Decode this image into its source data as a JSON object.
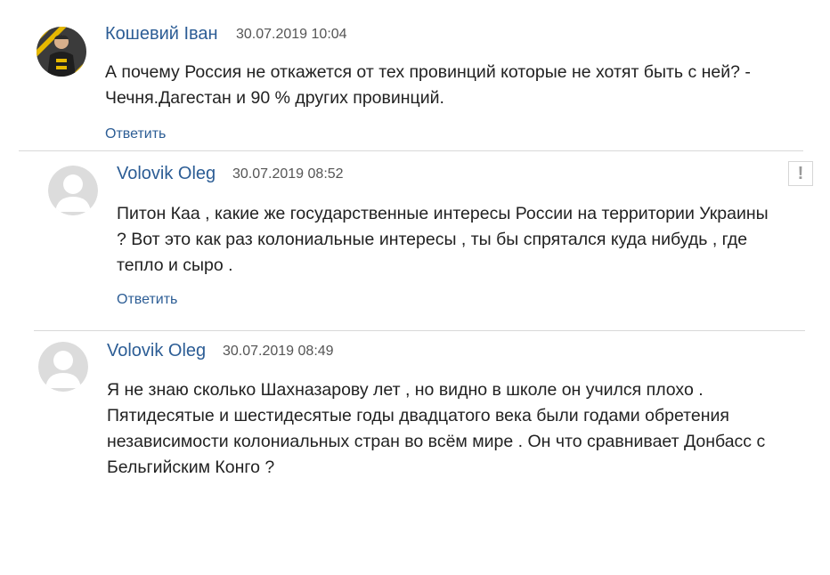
{
  "comments": [
    {
      "author": "Кошевий Іван",
      "date": "30.07.2019 10:04",
      "text": "А почему Россия не откажется от тех провинций которые не хотят быть с ней? - Чечня.Дагестан и 90 % других провинций.",
      "reply_label": "Ответить",
      "avatar_icon": "user-photo-avatar"
    },
    {
      "author": "Volovik Oleg",
      "date": "30.07.2019 08:52",
      "text": "Питон Каа , какие же государственные интересы России на территории Украины ? Вот это как раз колониальные интересы , ты бы спрятался куда нибудь , где тепло и сыро .",
      "reply_label": "Ответить",
      "avatar_icon": "default-user-avatar",
      "report_icon": "exclamation-icon"
    },
    {
      "author": "Volovik Oleg",
      "date": "30.07.2019 08:49",
      "text": "Я не знаю сколько Шахназарову лет , но видно в школе он учился плохо . Пятидесятые и шестидесятые годы двадцатого века были годами обретения независимости колониальных стран во всём мире . Он что сравнивает Донбасс с Бельгийским Конго ?",
      "avatar_icon": "default-user-avatar"
    }
  ],
  "colors": {
    "link": "#2c5d95",
    "text": "#222222",
    "date": "#555555",
    "divider": "#d9d9d9",
    "avatar_placeholder": "#dcdcdc"
  }
}
